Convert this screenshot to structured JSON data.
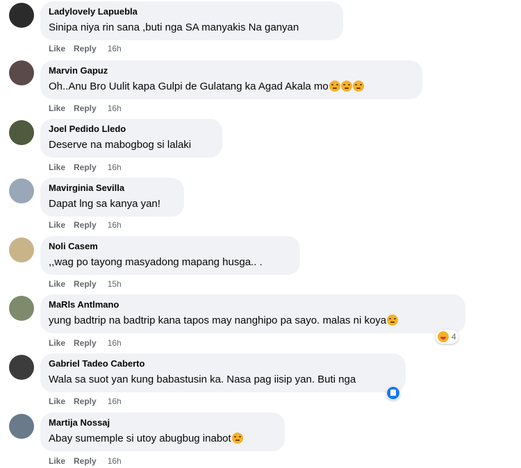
{
  "comments": [
    {
      "name": "Ladylovely Lapuebla",
      "text": "Sinipa niya rin sana ,buti nga SA manyakis Na ganyan",
      "emojis": 0,
      "time": "16h",
      "avatar_color": "#2b2b2b"
    },
    {
      "name": "Marvin Gapuz",
      "text": "Oh..Anu Bro Uulit kapa Gulpi de Gulatang ka Agad Akala mo",
      "emojis": 3,
      "time": "16h",
      "avatar_color": "#5a4a4a"
    },
    {
      "name": "Joel Pedido Lledo",
      "text": "Deserve na mabogbog si lalaki",
      "emojis": 0,
      "time": "16h",
      "avatar_color": "#4f5a3e"
    },
    {
      "name": "Mavirginia Sevilla",
      "text": "Dapat lng sa kanya yan!",
      "emojis": 0,
      "time": "16h",
      "avatar_color": "#9aa7b8"
    },
    {
      "name": "Noli Casem",
      "text": ",,wag po tayong masyadong mapang husga.. .",
      "emojis": 0,
      "time": "15h",
      "avatar_color": "#c9b48a"
    },
    {
      "name": "MaRls Antlmano",
      "text": "yung badtrip na badtrip kana tapos may nanghipo pa sayo. malas ni koya",
      "emojis": 1,
      "time": "16h",
      "avatar_color": "#7d8a6c",
      "reaction": {
        "type": "haha-icon",
        "count": "4"
      }
    },
    {
      "name": "Gabriel Tadeo Caberto",
      "text": "Wala sa suot yan kung babastusin ka. Nasa pag iisip yan. Buti nga",
      "emojis": 0,
      "time": "16h",
      "avatar_color": "#3c3c3c",
      "reaction": {
        "type": "like-icon",
        "count": ""
      }
    },
    {
      "name": "Martija Nossaj",
      "text": "Abay sumemple si utoy abugbug inabot",
      "emojis": 1,
      "time": "16h",
      "avatar_color": "#6a7a8a"
    }
  ],
  "actions": {
    "like": "Like",
    "reply": "Reply"
  }
}
